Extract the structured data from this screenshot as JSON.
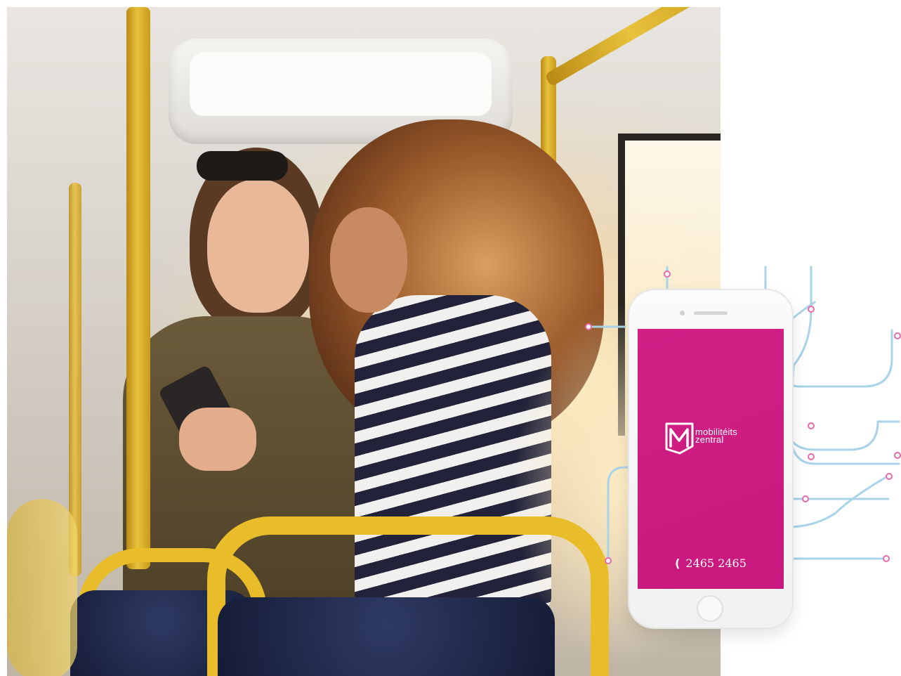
{
  "app": {
    "brand_line1": "mobilitéits",
    "brand_line2": "zentral",
    "phone_number": "2465 2465",
    "phone_icon": "phone-icon"
  },
  "colors": {
    "brand_magenta": "#c8197e",
    "network_line": "#a9d3e8",
    "network_node": "#e86aa8",
    "pole_yellow": "#e8c23c"
  }
}
